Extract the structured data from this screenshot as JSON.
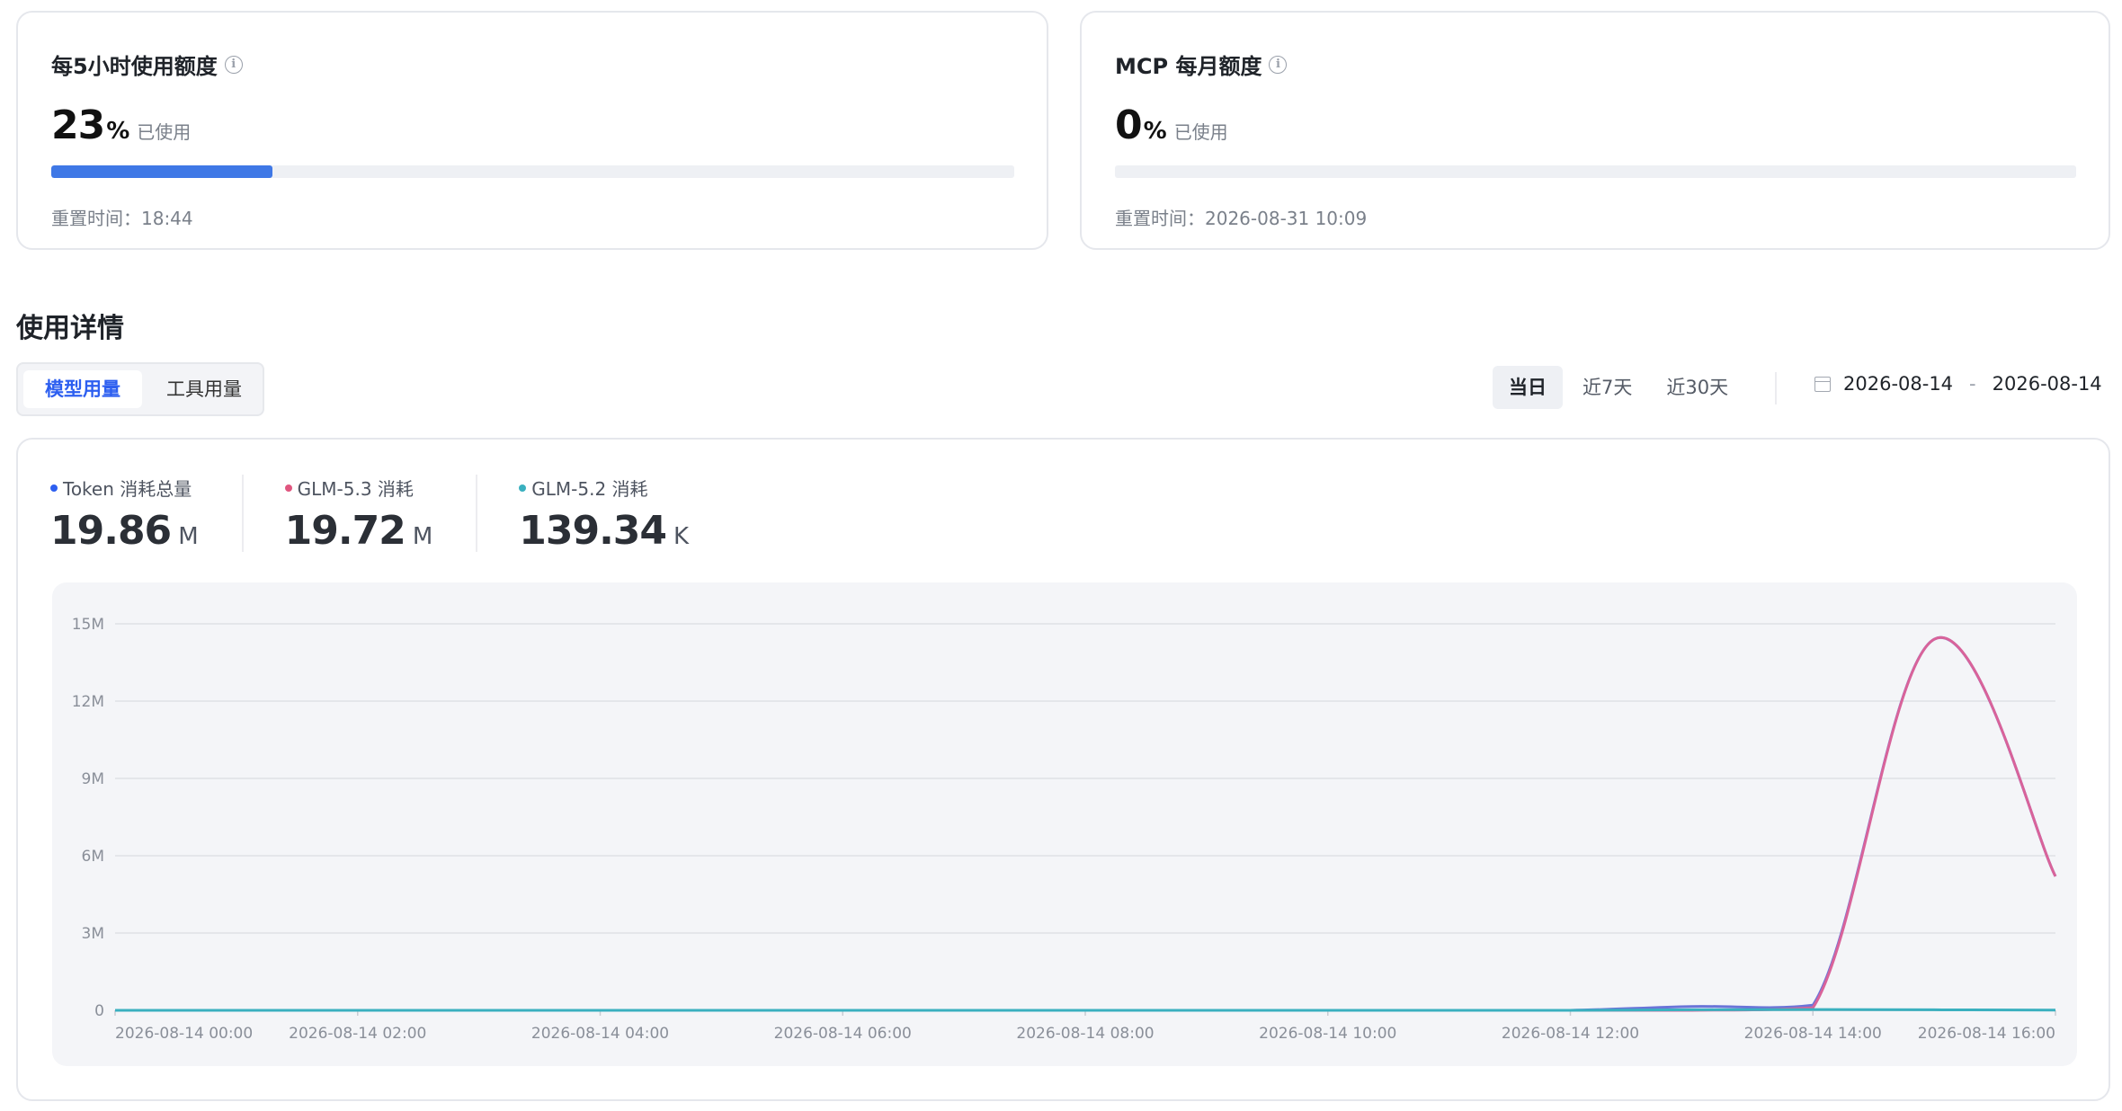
{
  "quota_cards": [
    {
      "title": "每5小时使用额度",
      "percent": "23",
      "percent_symbol": "%",
      "used_label": "已使用",
      "usage_fraction": 0.23,
      "reset_label": "重置时间：18:44"
    },
    {
      "title": "MCP 每月额度",
      "percent": "0",
      "percent_symbol": "%",
      "used_label": "已使用",
      "usage_fraction": 0.0,
      "reset_label": "重置时间：2026-08-31 10:09"
    }
  ],
  "details": {
    "title": "使用详情",
    "tabs": [
      "模型用量",
      "工具用量"
    ],
    "active_tab": "模型用量",
    "ranges": [
      "当日",
      "近7天",
      "近30天"
    ],
    "active_range": "当日",
    "date_start": "2026-08-14",
    "date_separator": "-",
    "date_end": "2026-08-14"
  },
  "stats": [
    {
      "label": "Token 消耗总量",
      "value": "19.86",
      "unit": "M",
      "color": "#2d5ff0"
    },
    {
      "label": "GLM-5.3 消耗",
      "value": "19.72",
      "unit": "M",
      "color": "#e0567f"
    },
    {
      "label": "GLM-5.2 消耗",
      "value": "139.34",
      "unit": "K",
      "color": "#3ab0bf"
    }
  ],
  "chart_data": {
    "type": "line",
    "ylim": [
      0,
      15000000
    ],
    "y_ticks": [
      "0",
      "3M",
      "6M",
      "9M",
      "12M",
      "15M"
    ],
    "x_ticks": [
      "2026-08-14 00:00",
      "2026-08-14 02:00",
      "2026-08-14 04:00",
      "2026-08-14 06:00",
      "2026-08-14 08:00",
      "2026-08-14 10:00",
      "2026-08-14 12:00",
      "2026-08-14 14:00",
      "2026-08-14 16:00"
    ],
    "x": [
      "00:00",
      "01:00",
      "02:00",
      "03:00",
      "04:00",
      "05:00",
      "06:00",
      "07:00",
      "08:00",
      "09:00",
      "10:00",
      "11:00",
      "12:00",
      "13:00",
      "14:00",
      "15:00",
      "16:00"
    ],
    "series": [
      {
        "color": "#6a74d8",
        "values": [
          0,
          0,
          0,
          0,
          0,
          0,
          0,
          0,
          0,
          0,
          0,
          0,
          0,
          150000,
          200000,
          14400000,
          5200000
        ]
      },
      {
        "color": "#d9639a",
        "values": [
          0,
          0,
          0,
          0,
          0,
          0,
          0,
          0,
          0,
          0,
          0,
          0,
          0,
          0,
          100000,
          14400000,
          5200000
        ]
      },
      {
        "color": "#3ab0bf",
        "values": [
          0,
          0,
          0,
          0,
          0,
          0,
          0,
          0,
          0,
          0,
          0,
          0,
          0,
          20000,
          30000,
          20000,
          10000
        ]
      }
    ],
    "grid": true
  }
}
